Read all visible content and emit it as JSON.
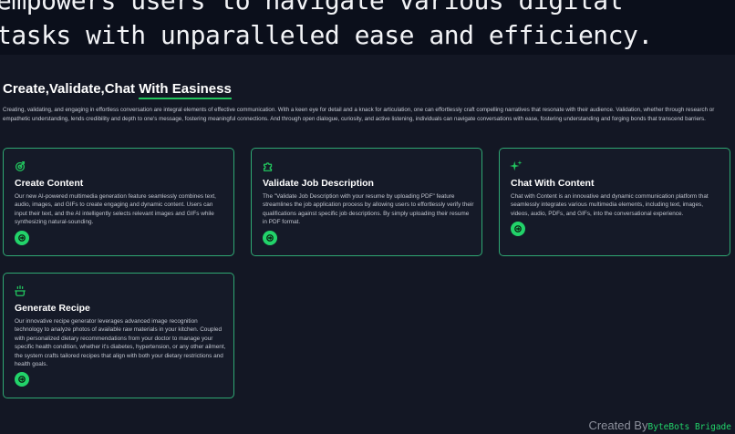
{
  "hero": {
    "line1": "empowers users to navigate various digital",
    "line2": "tasks with unparalleled ease and efficiency."
  },
  "section": {
    "heading_prefix": "Create,Validate,Chat ",
    "heading_accent": "With Easiness",
    "intro": "Creating, validating, and engaging in effortless conversation are integral elements of effective communication. With a keen eye for detail and a knack for articulation, one can effortlessly craft compelling narratives that resonate with their audience. Validation, whether through research or empathetic understanding, lends credibility and depth to one's message, fostering meaningful connections. And through open dialogue, curiosity, and active listening, individuals can navigate conversations with ease, fostering understanding and forging bonds that transcend barriers."
  },
  "cards": [
    {
      "icon": "bullseye-icon",
      "title": "Create Content",
      "description": "Our new AI-powered multimedia generation feature seamlessly combines text, audio, images, and GIFs to create engaging and dynamic content. Users can input their text, and the AI intelligently selects relevant images and GIFs while synthesizing natural-sounding."
    },
    {
      "icon": "puzzle-icon",
      "title": "Validate Job Description",
      "description": "The \"Validate Job Description with your resume by uploading PDF\" feature streamlines the job application process by allowing users to effortlessly verify their qualifications against specific job descriptions. By simply uploading their resume in PDF format."
    },
    {
      "icon": "sparkles-icon",
      "title": "Chat With Content",
      "description": "Chat with Content is an innovative and dynamic communication platform that seamlessly integrates various multimedia elements, including text, images, videos, audio, PDFs, and GIFs, into the conversational experience."
    },
    {
      "icon": "cooking-pot-icon",
      "title": "Generate Recipe",
      "description": "Our innovative recipe generator leverages advanced image recognition technology to analyze photos of available raw materials in your kitchen. Coupled with personalized dietary recommendations from your doctor to manage your specific health condition, whether it's diabetes, hypertension, or any other ailment, the system crafts tailored recipes that align with both your dietary restrictions and health goals."
    }
  ],
  "footer": {
    "created_by": "Created By",
    "brand": "ByteBots Brigade"
  },
  "colors": {
    "accent": "#22c55e",
    "card_border": "#2fa873",
    "background": "#131724",
    "hero_background": "#0b0f1b"
  }
}
